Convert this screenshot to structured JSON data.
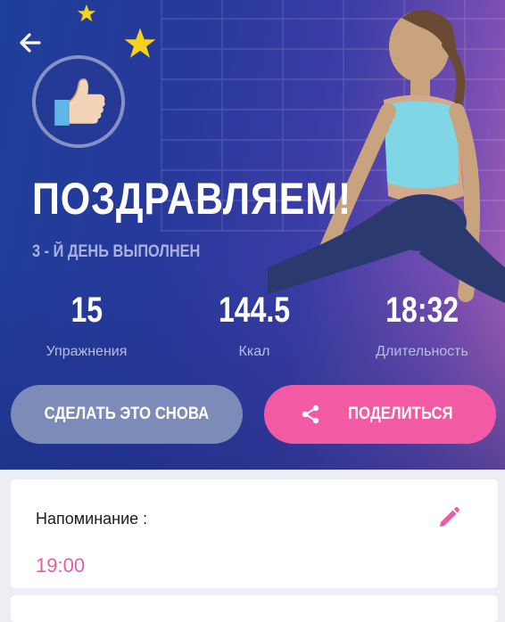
{
  "hero": {
    "title": "ПОЗДРАВЛЯЕМ!",
    "subtitle": "3 - Й ДЕНЬ ВЫПОЛНЕН",
    "stats": [
      {
        "value": "15",
        "label": "Упражнения"
      },
      {
        "value": "144.5",
        "label": "Ккал"
      },
      {
        "value": "18:32",
        "label": "Длительность"
      }
    ],
    "icons": {
      "back": "arrow-left-icon",
      "badge": "thumbs-up-icon",
      "stars": "star-icon"
    }
  },
  "actions": {
    "repeat_label": "СДЕЛАТЬ ЭТО СНОВА",
    "share_label": "ПОДЕЛИТЬСЯ"
  },
  "reminder": {
    "label": "Напоминание :",
    "time": "19:00"
  },
  "colors": {
    "accent": "#f25aa4",
    "repeat_button": "#7d8bb8",
    "hero_bg": "#28399b",
    "star": "#f6d21c"
  }
}
